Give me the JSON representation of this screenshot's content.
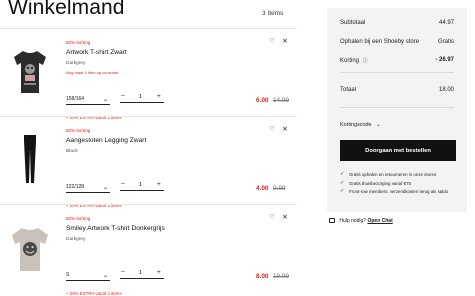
{
  "header": {
    "title": "Winkelmand",
    "count": "3 Items"
  },
  "items": [
    {
      "tag": "60% korting",
      "name": "Artwork T-shirt Zwart",
      "color": "Darkgrey",
      "stock": "Nog maar 1 item op voorraad",
      "size": "158/164",
      "qty": "1",
      "price_new": "6.00",
      "price_old": "14.99",
      "extra": "+ 20% EXTRA vanaf 3 items"
    },
    {
      "tag": "60% korting",
      "name": "Aangesloten Legging Zwart",
      "color": "Black",
      "stock": "",
      "size": "122/128",
      "qty": "1",
      "price_new": "4.00",
      "price_old": "9.99",
      "extra": "+ 20% EXTRA vanaf 3 items"
    },
    {
      "tag": "60% korting",
      "name": "Smiley Artwork T-shirt Donkergrijs",
      "color": "Darkgrey",
      "stock": "",
      "size": "S",
      "qty": "1",
      "price_new": "8.00",
      "price_old": "19.99",
      "extra": "+ 20% EXTRA vanaf 3 items"
    }
  ],
  "summary": {
    "subtotal_label": "Subtotaal",
    "subtotal_value": "44.97",
    "pickup_label": "Ophalen bij een Shoeby store",
    "pickup_value": "Gratis",
    "discount_label": "Korting",
    "discount_value": "- 26.97",
    "total_label": "Totaal",
    "total_value": "18.00",
    "coupon_label": "Kortingscode",
    "checkout_label": "Doorgaan met bestellen",
    "perks": [
      "Gratis ophalen en retourneren in onze stores",
      "Gratis thuisbezorging vanaf €75",
      "Front-row members: verzendkosten terug als saldo"
    ]
  },
  "help": {
    "question": "Hulp nodig?",
    "link": "Open Chat"
  },
  "icons": {
    "favorite": "heart-icon",
    "remove": "close-icon",
    "chevron": "chevron-down-icon",
    "check": "check-icon",
    "info": "info-icon",
    "chat": "chat-icon"
  },
  "colors": {
    "sale": "#e0241a",
    "panel": "#f3f3f3",
    "button": "#111111"
  }
}
